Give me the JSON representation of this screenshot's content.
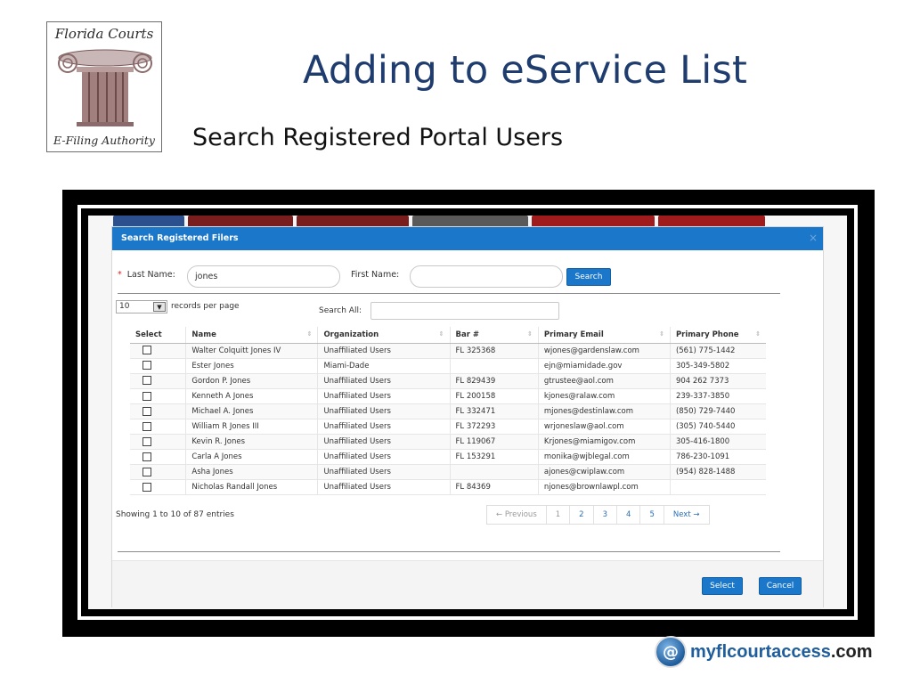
{
  "logo": {
    "top_text": "Florida Courts",
    "bottom_text": "E-Filing Authority",
    "icon": "ionic-column-icon"
  },
  "slide": {
    "title": "Adding to eService List",
    "subtitle": "Search Registered Portal Users"
  },
  "modal": {
    "title": "Search Registered Filers",
    "close_symbol": "×",
    "last_name_label": "Last Name:",
    "required_mark": "*",
    "last_name_value": "jones",
    "first_name_label": "First Name:",
    "first_name_value": "",
    "search_button": "Search",
    "records_per_page_value": "10",
    "records_per_page_label": "records per page",
    "search_all_label": "Search All:",
    "search_all_value": ""
  },
  "table": {
    "columns": [
      "Select",
      "Name",
      "Organization",
      "Bar #",
      "Primary Email",
      "Primary Phone"
    ],
    "rows": [
      {
        "name": "Walter Colquitt Jones IV",
        "org": "Unaffiliated Users",
        "bar": "FL 325368",
        "email": "wjones@gardenslaw.com",
        "phone": "(561) 775-1442"
      },
      {
        "name": "Ester Jones",
        "org": "Miami-Dade",
        "bar": "",
        "email": "ejn@miamidade.gov",
        "phone": "305-349-5802"
      },
      {
        "name": "Gordon P. Jones",
        "org": "Unaffiliated Users",
        "bar": "FL 829439",
        "email": "gtrustee@aol.com",
        "phone": "904 262 7373"
      },
      {
        "name": "Kenneth A Jones",
        "org": "Unaffiliated Users",
        "bar": "FL 200158",
        "email": "kjones@ralaw.com",
        "phone": "239-337-3850"
      },
      {
        "name": "Michael A. Jones",
        "org": "Unaffiliated Users",
        "bar": "FL 332471",
        "email": "mjones@destinlaw.com",
        "phone": "(850) 729-7440"
      },
      {
        "name": "William R Jones III",
        "org": "Unaffiliated Users",
        "bar": "FL 372293",
        "email": "wrjoneslaw@aol.com",
        "phone": "(305) 740-5440"
      },
      {
        "name": "Kevin R. Jones",
        "org": "Unaffiliated Users",
        "bar": "FL 119067",
        "email": "Krjones@miamigov.com",
        "phone": "305-416-1800"
      },
      {
        "name": "Carla A Jones",
        "org": "Unaffiliated Users",
        "bar": "FL 153291",
        "email": "monika@wjblegal.com",
        "phone": "786-230-1091"
      },
      {
        "name": "Asha Jones",
        "org": "Unaffiliated Users",
        "bar": "",
        "email": "ajones@cwiplaw.com",
        "phone": "(954) 828-1488"
      },
      {
        "name": "Nicholas Randall Jones",
        "org": "Unaffiliated Users",
        "bar": "FL 84369",
        "email": "njones@brownlawpl.com",
        "phone": ""
      }
    ]
  },
  "pagination": {
    "showing_text": "Showing 1 to 10 of 87 entries",
    "previous": "← Previous",
    "pages": [
      "1",
      "2",
      "3",
      "4",
      "5"
    ],
    "next": "Next →"
  },
  "footer": {
    "select_button": "Select",
    "cancel_button": "Cancel"
  },
  "brand": {
    "icon_glyph": "@",
    "name": "myflcourtaccess",
    "suffix": ".com"
  }
}
